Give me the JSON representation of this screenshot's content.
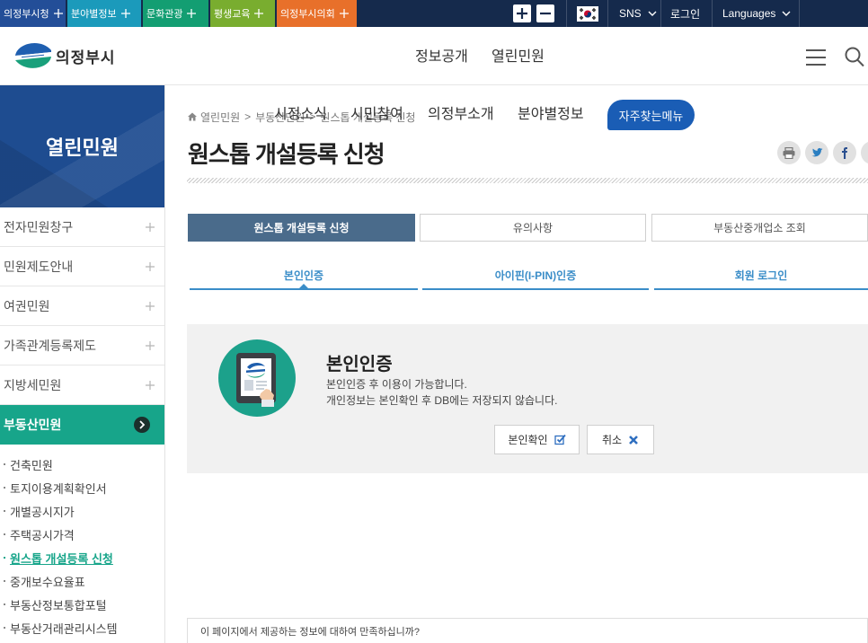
{
  "topbar": {
    "background": "#152a4c",
    "site_tabs": [
      {
        "label": "의정부시청",
        "color": "#234e98",
        "icon": "plus-icon"
      },
      {
        "label": "분야별정보",
        "color": "#1b9abb",
        "icon": "plus-icon"
      },
      {
        "label": "문화관광",
        "color": "#139e72",
        "icon": "plus-icon"
      },
      {
        "label": "평생교육",
        "color": "#79ad2f",
        "icon": "plus-icon"
      },
      {
        "label": "의정부시의회",
        "color": "#e8702a",
        "icon": "plus-icon"
      }
    ],
    "zoom_in_icon": "plus-icon",
    "zoom_out_icon": "minus-icon",
    "language_flag_icon": "korean-flag-icon",
    "sns_label": "SNS",
    "login_label": "로그인",
    "languages_label": "Languages",
    "dropdown_icon": "chevron-down-icon"
  },
  "header": {
    "logo_icon": "uijeongbu-emblem-icon",
    "logo_text": "의정부시",
    "nav": [
      {
        "label": "정보공개"
      },
      {
        "label": "열린민원"
      }
    ],
    "menu_icon": "hamburger-icon",
    "search_icon": "search-icon"
  },
  "mega_nav": {
    "items": [
      {
        "label": "시정소식"
      },
      {
        "label": "시민참여"
      },
      {
        "label": "의정부소개"
      },
      {
        "label": "분야별정보"
      }
    ],
    "favorites_label": "자주찾는메뉴",
    "favorites_color": "#1a5db5"
  },
  "sidebar": {
    "title": "열린민원",
    "title_background": "#1e4c90",
    "menu": [
      {
        "label": "전자민원창구",
        "icon": "plus-icon"
      },
      {
        "label": "민원제도안내",
        "icon": "plus-icon"
      },
      {
        "label": "여권민원",
        "icon": "plus-icon"
      },
      {
        "label": "가족관계등록제도",
        "icon": "plus-icon"
      },
      {
        "label": "지방세민원",
        "icon": "plus-icon"
      },
      {
        "label": "부동산민원",
        "icon": "chevron-right-circle-icon",
        "active": true
      }
    ],
    "active_color": "#17a58a",
    "submenu": [
      {
        "label": "건축민원"
      },
      {
        "label": "토지이용계획확인서"
      },
      {
        "label": "개별공시지가"
      },
      {
        "label": "주택공시가격"
      },
      {
        "label": "원스톱 개설등록 신청",
        "active": true
      },
      {
        "label": "중개보수요율표"
      },
      {
        "label": "부동산정보통합포털"
      },
      {
        "label": "부동산거래관리시스템"
      }
    ]
  },
  "breadcrumb": {
    "home_icon": "home-icon",
    "separator": ">",
    "items": [
      "열린민원",
      "부동산민원",
      "원스톱 개설등록 신청"
    ]
  },
  "page_title": "원스톱 개설등록 신청",
  "share": {
    "icons": [
      "print-icon",
      "twitter-icon",
      "facebook-icon",
      "share-more-icon"
    ]
  },
  "tabs": {
    "items": [
      {
        "label": "원스톱 개설등록 신청",
        "active": true
      },
      {
        "label": "유의사항"
      },
      {
        "label": "부동산중개업소 조회"
      }
    ],
    "active_color": "#4a6b8b"
  },
  "auth_tabs": {
    "items": [
      {
        "label": "본인인증",
        "active": true
      },
      {
        "label": "아이핀(I-PIN)인증"
      },
      {
        "label": "회원 로그인"
      }
    ],
    "color": "#3a8dc8"
  },
  "auth_panel": {
    "icon": "tablet-verification-icon",
    "title": "본인인증",
    "lines": [
      "본인인증 후 이용이 가능합니다.",
      "개인정보는 본인확인 후 DB에는 저장되지 않습니다."
    ],
    "confirm_label": "본인확인",
    "confirm_icon": "check-square-icon",
    "cancel_label": "취소",
    "cancel_icon": "close-icon",
    "background": "#f1f1f1"
  },
  "satisfaction": {
    "question": "이 페이지에서 제공하는 정보에 대하여 만족하십니까?"
  }
}
